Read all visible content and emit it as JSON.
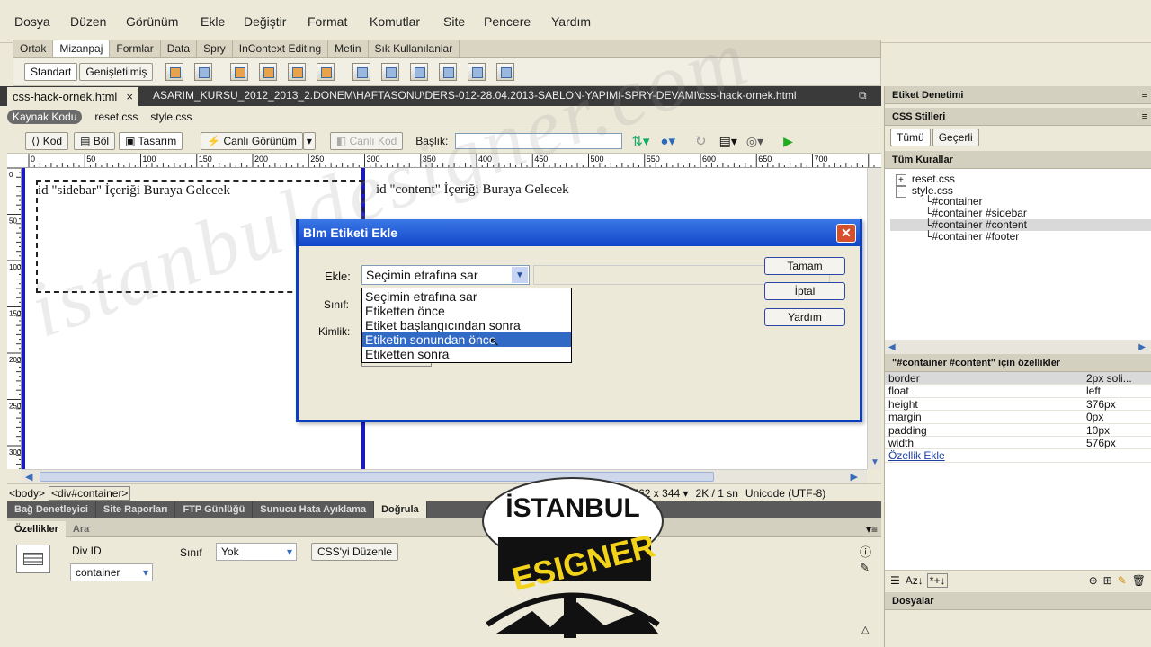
{
  "menubar": [
    "Dosya",
    "Düzen",
    "Görünüm",
    "Ekle",
    "Değiştir",
    "Format",
    "Komutlar",
    "Site",
    "Pencere",
    "Yardım"
  ],
  "insert_tabs": [
    "Ortak",
    "Mizanpaj",
    "Formlar",
    "Data",
    "Spry",
    "InContext Editing",
    "Metin",
    "Sık Kullanılanlar"
  ],
  "insert_toolbar": {
    "standart": "Standart",
    "genisletilmis": "Genişletilmiş"
  },
  "doc": {
    "tab_title": "css-hack-ornek.html",
    "tab_close": "×",
    "path": "ASARIM_KURSU_2012_2013_2.DONEM\\HAFTASONU\\DERS-012-28.04.2013-SABLON-YAPIMI-SPRY-DEVAMI\\css-hack-ornek.html",
    "related_files": [
      "Kaynak Kodu",
      "reset.css",
      "style.css"
    ]
  },
  "doc_toolbar": {
    "kod": "Kod",
    "bol": "Böl",
    "tasarim": "Tasarım",
    "canli": "Canlı Görünüm",
    "canli_kod": "Canlı Kod",
    "baslik_label": "Başlık:",
    "baslik_value": ""
  },
  "ruler": {
    "top": [
      "0",
      "50",
      "100",
      "150",
      "200",
      "250",
      "300",
      "350",
      "400",
      "450",
      "500",
      "550",
      "600",
      "650",
      "700"
    ],
    "left": [
      "0",
      "50",
      "100",
      "150",
      "200",
      "250",
      "300"
    ]
  },
  "design": {
    "sidebar_text": "id \"sidebar\" İçeriği Buraya Gelecek",
    "content_text": "id \"content\" İçeriği Buraya Gelecek"
  },
  "status_bar": {
    "tag_body": "<body>",
    "tag_div": "<div#container>",
    "size": "762 x 344 ▾",
    "weight": "2K / 1 sn",
    "encoding": "Unicode (UTF-8)"
  },
  "dialog": {
    "title": "Blm Etiketi Ekle",
    "close": "✕",
    "ekle_label": "Ekle:",
    "ekle_value": "Seçimin etrafına sar",
    "sinif_label": "Sınıf:",
    "kimlik_label": "Kimlik:",
    "options": [
      "Seçimin etrafına sar",
      "Etiketten önce",
      "Etiket başlangıcından sonra",
      "Etiketin sonundan önce",
      "Etiketten sonra"
    ],
    "highlighted_option": 3,
    "btn_ok": "Tamam",
    "btn_cancel": "İptal",
    "btn_help": "Yardım"
  },
  "right_panel": {
    "etiket_denetimi": "Etiket Denetimi",
    "css_stilleri": "CSS Stilleri",
    "tab_tumu": "Tümü",
    "tab_gecerli": "Geçerli",
    "tum_kurallar": "Tüm Kurallar",
    "files": [
      "reset.css",
      "style.css"
    ],
    "rules": [
      "#container",
      "#container #sidebar",
      "#container #content",
      "#container #footer"
    ],
    "selected_rule": 2,
    "props_title": "\"#container #content\" için özellikler",
    "props": [
      {
        "k": "border",
        "v": "2px soli..."
      },
      {
        "k": "float",
        "v": "left"
      },
      {
        "k": "height",
        "v": "376px"
      },
      {
        "k": "margin",
        "v": "0px"
      },
      {
        "k": "padding",
        "v": "10px"
      },
      {
        "k": "width",
        "v": "576px"
      }
    ],
    "add_prop": "Özellik Ekle",
    "dosyalar": "Dosyalar"
  },
  "bottom_tabs": [
    "Bağ Denetleyici",
    "Site Raporları",
    "FTP Günlüğü",
    "Sunucu Hata Ayıklama",
    "Doğrula"
  ],
  "properties": {
    "tabs": [
      "Özellikler",
      "Ara"
    ],
    "div_id_label": "Div ID",
    "div_id_value": "container",
    "sinif_label": "Sınıf",
    "sinif_value": "Yok",
    "css_button": "CSS'yi Düzenle"
  },
  "watermark": "istanbuldesigner.com",
  "logo": {
    "line1": "İSTANBUL",
    "line2": "ESIGNER"
  },
  "colors": {
    "dialog_title": "#1246c9",
    "highlight": "#316ac5",
    "design_border": "#1b1bbd"
  }
}
